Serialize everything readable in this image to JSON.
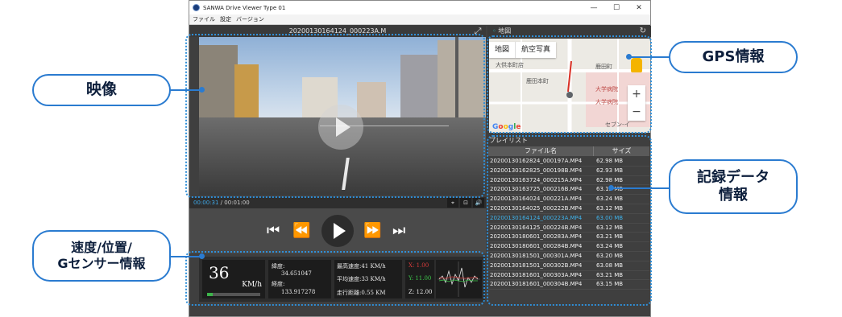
{
  "window": {
    "title": "SANWA Drive Viewer Type 01",
    "menu": [
      "ファイル",
      "設定",
      "バージョン"
    ],
    "controls": {
      "minimize": "—",
      "maximize": "☐",
      "close": "✕"
    }
  },
  "video": {
    "filename": "20200130164124_000223A.M",
    "current_time": "00:00:31",
    "total_time": " / 00:01:00",
    "mini_controls": [
      "⌖",
      "⊡",
      "🔊"
    ]
  },
  "playback": {
    "prev": "⏮",
    "rewind": "⏪",
    "forward": "⏩",
    "next": "⏭"
  },
  "info": {
    "speed": "36",
    "speed_unit": "KM/h",
    "speed_level": 0.1,
    "lat_label": "緯度:",
    "lat_value": "34.651047",
    "lon_label": "経度:",
    "lon_value": "133.917278",
    "max_speed": "最高速度:41 KM/h",
    "avg_speed": "平均速度:33 KM/h",
    "distance": "走行距離:0.55 KM",
    "gx": "X: 1.00",
    "gy": "Y: 11.00",
    "gz": "Z: 12.00",
    "colors": {
      "gx": "#d83b3b",
      "gy": "#3cc44a",
      "gz": "#e8e8e8"
    }
  },
  "map": {
    "header": "地図",
    "pin_icon": "◦",
    "tabs": [
      "地図",
      "航空写真"
    ],
    "labels": [
      "大供本町店",
      "鹿田本町",
      "鹿田町",
      "大学病院",
      "大学病院",
      "セブン-イ"
    ],
    "zoom_in": "+",
    "zoom_out": "−",
    "google": "Google"
  },
  "playlist": {
    "header": "プレイリスト",
    "columns": [
      "ファイル名",
      "サイズ"
    ],
    "rows": [
      {
        "name": "20200130162824_000197A.MP4",
        "size": "62.98 MB"
      },
      {
        "name": "20200130162825_000198B.MP4",
        "size": "62.93 MB"
      },
      {
        "name": "20200130163724_000215A.MP4",
        "size": "62.98 MB"
      },
      {
        "name": "20200130163725_000216B.MP4",
        "size": "63.15 MB"
      },
      {
        "name": "20200130164024_000221A.MP4",
        "size": "63.24 MB"
      },
      {
        "name": "20200130164025_000222B.MP4",
        "size": "63.12 MB"
      },
      {
        "name": "20200130164124_000223A.MP4",
        "size": "63.00 MB",
        "active": true
      },
      {
        "name": "20200130164125_000224B.MP4",
        "size": "63.12 MB"
      },
      {
        "name": "20200130180601_000283A.MP4",
        "size": "63.21 MB"
      },
      {
        "name": "20200130180601_000284B.MP4",
        "size": "63.24 MB"
      },
      {
        "name": "20200130181501_000301A.MP4",
        "size": "63.20 MB"
      },
      {
        "name": "20200130181501_000302B.MP4",
        "size": "63.08 MB"
      },
      {
        "name": "20200130181601_000303A.MP4",
        "size": "63.21 MB"
      },
      {
        "name": "20200130181601_000304B.MP4",
        "size": "63.15 MB"
      }
    ]
  },
  "callouts": {
    "video": "映像",
    "sensor_line1": "速度/位置/",
    "sensor_line2": "Gセンサー情報",
    "gps": "GPS情報",
    "record_line1": "記録データ",
    "record_line2": "情報"
  },
  "accent": "#2a7bd0"
}
